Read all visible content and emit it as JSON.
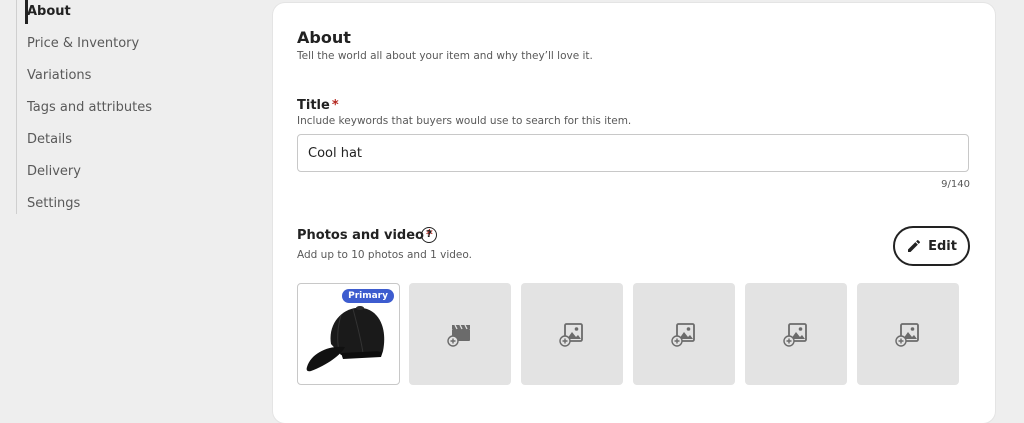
{
  "sidebar": {
    "items": [
      {
        "label": "About"
      },
      {
        "label": "Price & Inventory"
      },
      {
        "label": "Variations"
      },
      {
        "label": "Tags and attributes"
      },
      {
        "label": "Details"
      },
      {
        "label": "Delivery"
      },
      {
        "label": "Settings"
      }
    ]
  },
  "about": {
    "heading": "About",
    "description": "Tell the world all about your item and why they’ll love it."
  },
  "title_field": {
    "label": "Title",
    "required_mark": "*",
    "help": "Include keywords that buyers would use to search for this item.",
    "value": "Cool hat",
    "counter": "9/140"
  },
  "photos": {
    "label": "Photos and video",
    "required_mark": "*",
    "help_glyph": "?",
    "help": "Add up to 10 photos and 1 video.",
    "edit_label": "Edit",
    "primary_badge": "Primary",
    "slots": [
      {
        "kind": "photo",
        "icon": "black-baseball-cap-image"
      },
      {
        "kind": "add-video",
        "icon": "add-video-icon"
      },
      {
        "kind": "add-photo",
        "icon": "add-photo-icon"
      },
      {
        "kind": "add-photo",
        "icon": "add-photo-icon"
      },
      {
        "kind": "add-photo",
        "icon": "add-photo-icon"
      },
      {
        "kind": "add-photo",
        "icon": "add-photo-icon"
      }
    ]
  },
  "colors": {
    "accent_badge": "#3d5ccf",
    "required": "#b3261e"
  }
}
